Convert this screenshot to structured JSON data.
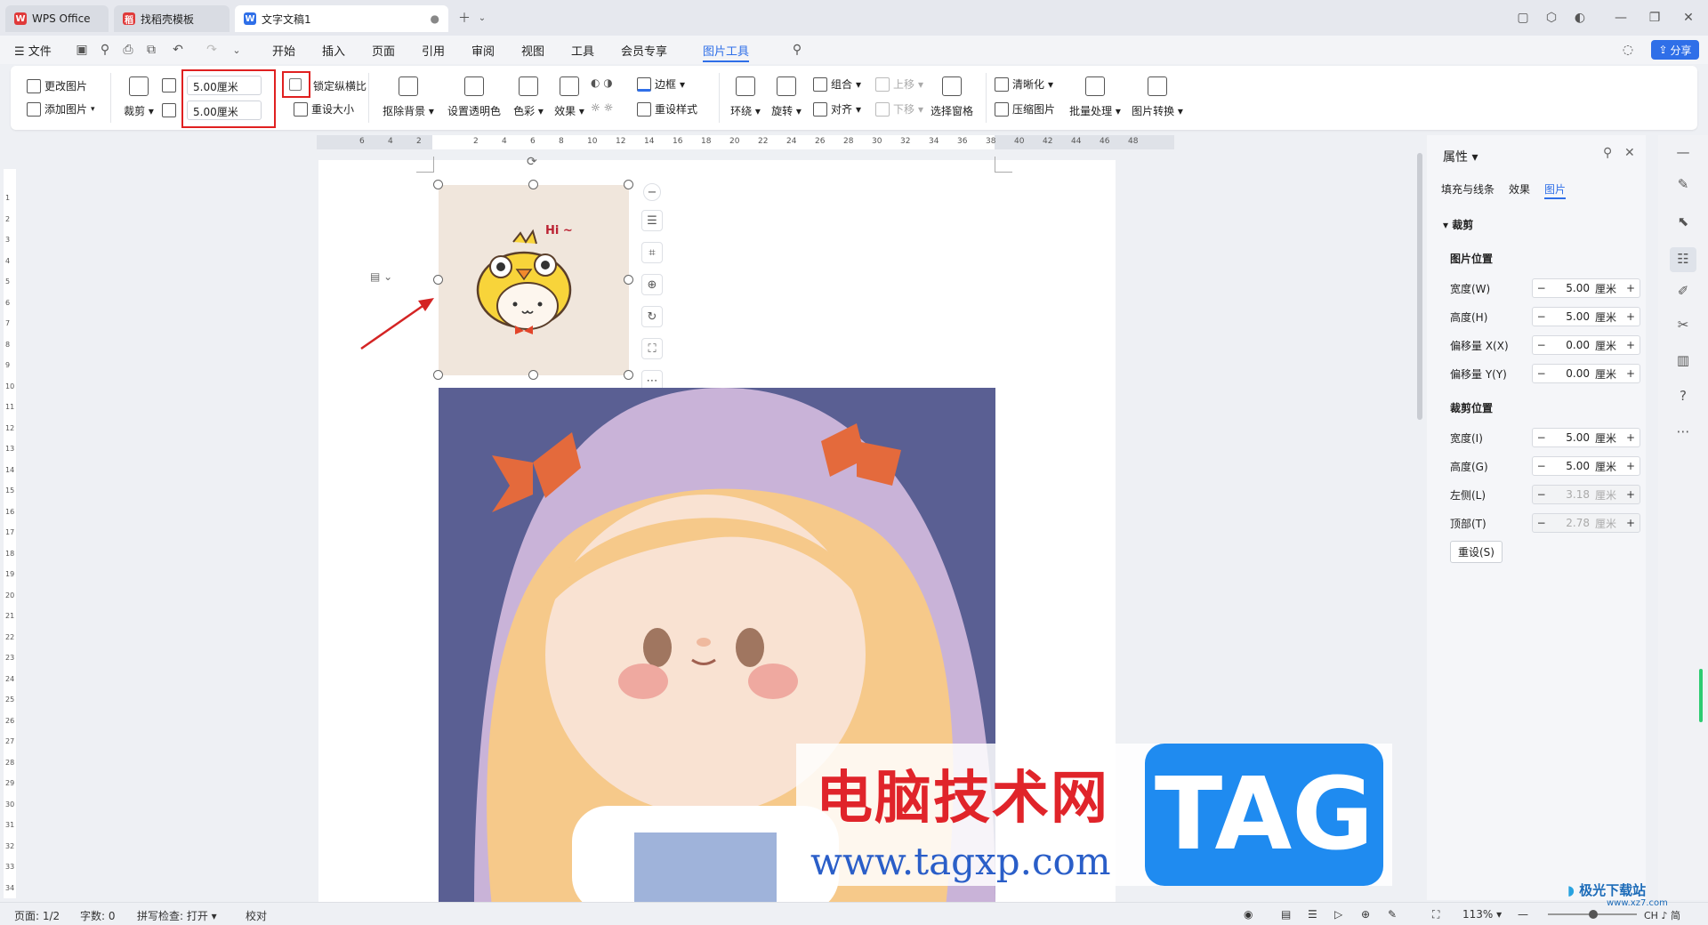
{
  "tabs": [
    {
      "label": "WPS Office",
      "logo": "W",
      "color": "#e03a3a"
    },
    {
      "label": "找稻壳模板",
      "logo": "稻",
      "color": "#e03a3a"
    },
    {
      "label": "文字文稿1",
      "logo": "W",
      "color": "#2f6fe8"
    }
  ],
  "menubar": {
    "file": "文件",
    "items": [
      "开始",
      "插入",
      "页面",
      "引用",
      "审阅",
      "视图",
      "工具",
      "会员专享",
      "图片工具"
    ],
    "share": "分享"
  },
  "ribbon": {
    "change_picture": "更改图片",
    "add_picture": "添加图片",
    "crop": "裁剪",
    "height_value": "5.00厘米",
    "width_value": "5.00厘米",
    "lock_ratio": "锁定纵横比",
    "reset_size": "重设大小",
    "remove_bg": "抠除背景",
    "set_transparent": "设置透明色",
    "color": "色彩",
    "effect": "效果",
    "border": "边框",
    "reset_style": "重设样式",
    "wrap": "环绕",
    "rotate": "旋转",
    "group": "组合",
    "align": "对齐",
    "bring_forward": "上移",
    "send_backward": "下移",
    "selection_pane": "选择窗格",
    "sharpen": "清晰化",
    "compress": "压缩图片",
    "batch": "批量处理",
    "convert": "图片转换"
  },
  "ruler_numbers": [
    "6",
    "4",
    "2",
    "",
    "2",
    "4",
    "6",
    "8",
    "10",
    "12",
    "14",
    "16",
    "18",
    "20",
    "22",
    "24",
    "26",
    "28",
    "30",
    "32",
    "34",
    "36",
    "38",
    "40",
    "42",
    "44",
    "46",
    "48"
  ],
  "vruler_numbers": [
    "1",
    "2",
    "3",
    "4",
    "5",
    "6",
    "7",
    "8",
    "9",
    "10",
    "11",
    "12",
    "13",
    "14",
    "15",
    "16",
    "17",
    "18",
    "19",
    "20",
    "21",
    "22",
    "23",
    "24",
    "25",
    "26",
    "27",
    "28",
    "29",
    "30",
    "31",
    "32",
    "33",
    "34"
  ],
  "sticker_text": "Hi ~",
  "watermark": {
    "cn": "电脑技术网",
    "url": "www.tagxp.com",
    "tag": "TAG"
  },
  "panel": {
    "title": "属性",
    "tabs": [
      "填充与线条",
      "效果",
      "图片"
    ],
    "section": "裁剪",
    "pic_position": "图片位置",
    "pic_fields": [
      {
        "label": "宽度(W)",
        "value": "5.00",
        "unit": "厘米"
      },
      {
        "label": "高度(H)",
        "value": "5.00",
        "unit": "厘米"
      },
      {
        "label": "偏移量 X(X)",
        "value": "0.00",
        "unit": "厘米"
      },
      {
        "label": "偏移量 Y(Y)",
        "value": "0.00",
        "unit": "厘米"
      }
    ],
    "crop_position": "裁剪位置",
    "crop_fields": [
      {
        "label": "宽度(I)",
        "value": "5.00",
        "unit": "厘米"
      },
      {
        "label": "高度(G)",
        "value": "5.00",
        "unit": "厘米"
      },
      {
        "label": "左侧(L)",
        "value": "3.18",
        "unit": "厘米"
      },
      {
        "label": "顶部(T)",
        "value": "2.78",
        "unit": "厘米"
      }
    ],
    "reset": "重设(S)"
  },
  "status": {
    "page": "页面: 1/2",
    "words": "字数: 0",
    "spell": "拼写检查: 打开",
    "proof": "校对",
    "zoom": "113%",
    "ime": "CH ♪ 简"
  },
  "corner_logo": "极光下载站",
  "corner_url": "www.xz7.com",
  "colors": {
    "accent": "#2f6fe8",
    "highlight": "#e02020"
  }
}
